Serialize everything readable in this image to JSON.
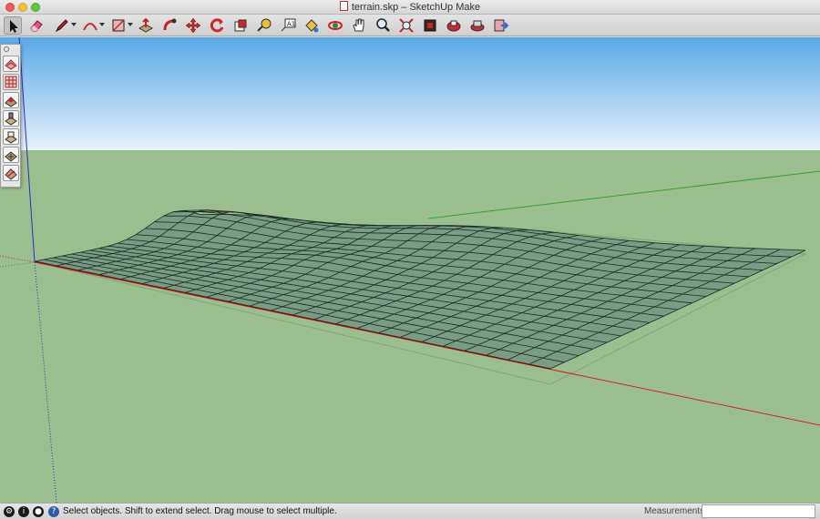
{
  "window": {
    "title": "terrain.skp – SketchUp Make"
  },
  "toolbar": {
    "tools": [
      {
        "name": "select-tool",
        "icon": "arrow-icon"
      },
      {
        "name": "eraser-tool",
        "icon": "eraser-icon"
      },
      {
        "name": "line-tool",
        "icon": "pencil-icon"
      },
      {
        "name": "arc-tool",
        "icon": "arc-icon"
      },
      {
        "name": "shapes-tool",
        "icon": "rectangle-icon"
      },
      {
        "name": "push-pull-tool",
        "icon": "push-pull-icon"
      },
      {
        "name": "follow-me-tool",
        "icon": "follow-me-icon"
      },
      {
        "name": "move-tool",
        "icon": "move-icon"
      },
      {
        "name": "rotate-tool",
        "icon": "rotate-icon"
      },
      {
        "name": "scale-tool",
        "icon": "scale-icon"
      },
      {
        "name": "tape-measure-tool",
        "icon": "tape-measure-icon"
      },
      {
        "name": "text-tool",
        "icon": "text-icon"
      },
      {
        "name": "paint-bucket-tool",
        "icon": "paint-bucket-icon"
      },
      {
        "name": "orbit-tool",
        "icon": "orbit-icon"
      },
      {
        "name": "pan-tool",
        "icon": "hand-icon"
      },
      {
        "name": "zoom-tool",
        "icon": "magnifier-icon"
      },
      {
        "name": "zoom-extents-tool",
        "icon": "zoom-extents-icon"
      },
      {
        "name": "3d-warehouse-tool",
        "icon": "warehouse-icon"
      },
      {
        "name": "share-model-tool",
        "icon": "share-model-icon"
      },
      {
        "name": "extension-warehouse-tool",
        "icon": "extension-icon"
      },
      {
        "name": "send-to-layout-tool",
        "icon": "layout-icon"
      }
    ]
  },
  "sandbox": {
    "tools": [
      {
        "name": "from-contours-tool",
        "icon": "contours-icon"
      },
      {
        "name": "from-scratch-tool",
        "icon": "grid-icon"
      },
      {
        "name": "smoove-tool",
        "icon": "smoove-icon"
      },
      {
        "name": "stamp-tool",
        "icon": "stamp-icon"
      },
      {
        "name": "drape-tool",
        "icon": "drape-icon"
      },
      {
        "name": "add-detail-tool",
        "icon": "add-detail-icon"
      },
      {
        "name": "flip-edge-tool",
        "icon": "flip-edge-icon"
      }
    ]
  },
  "colors": {
    "sky_top": "#5aa9e6",
    "sky_bottom": "#e7f2fb",
    "ground": "#9bbe8e",
    "mesh_fill": "#6e9180",
    "axis_red": "#d42020",
    "axis_green": "#2da52d",
    "axis_blue": "#2b2bd0"
  },
  "statusbar": {
    "message": "Select objects. Shift to extend select. Drag mouse to select multiple.",
    "measurements_label": "Measurements",
    "measurements_value": ""
  }
}
